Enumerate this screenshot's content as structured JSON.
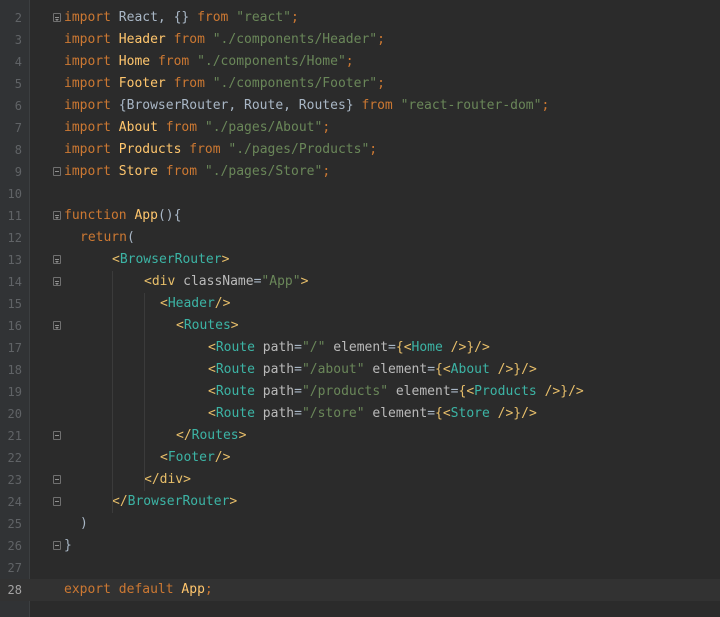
{
  "editor": {
    "language": "javascript-jsx",
    "current_line": 28,
    "colors": {
      "background": "#2b2b2b",
      "gutter": "#313335",
      "keyword": "#cc7832",
      "string": "#6a8759",
      "tag": "#e8bf6a",
      "component": "#3cb4a5",
      "function": "#ffc66d",
      "text": "#a9b7c6"
    },
    "lines": [
      {
        "n": "2",
        "indent": 0,
        "fold": "open",
        "tokens": [
          [
            "kw",
            "import"
          ],
          [
            "def",
            " React, {} "
          ],
          [
            "kw",
            "from"
          ],
          [
            "def",
            " "
          ],
          [
            "str",
            "\"react\""
          ],
          [
            "kw",
            ";"
          ]
        ]
      },
      {
        "n": "3",
        "indent": 0,
        "tokens": [
          [
            "kw",
            "import"
          ],
          [
            "def",
            " "
          ],
          [
            "fn",
            "Header"
          ],
          [
            "def",
            " "
          ],
          [
            "kw",
            "from"
          ],
          [
            "def",
            " "
          ],
          [
            "str",
            "\"./components/Header\""
          ],
          [
            "kw",
            ";"
          ]
        ]
      },
      {
        "n": "4",
        "indent": 0,
        "tokens": [
          [
            "kw",
            "import"
          ],
          [
            "def",
            " "
          ],
          [
            "fn",
            "Home"
          ],
          [
            "def",
            " "
          ],
          [
            "kw",
            "from"
          ],
          [
            "def",
            " "
          ],
          [
            "str",
            "\"./components/Home\""
          ],
          [
            "kw",
            ";"
          ]
        ]
      },
      {
        "n": "5",
        "indent": 0,
        "tokens": [
          [
            "kw",
            "import"
          ],
          [
            "def",
            " "
          ],
          [
            "fn",
            "Footer"
          ],
          [
            "def",
            " "
          ],
          [
            "kw",
            "from"
          ],
          [
            "def",
            " "
          ],
          [
            "str",
            "\"./components/Footer\""
          ],
          [
            "kw",
            ";"
          ]
        ]
      },
      {
        "n": "6",
        "indent": 0,
        "tokens": [
          [
            "kw",
            "import"
          ],
          [
            "def",
            " {"
          ],
          [
            "def",
            "BrowserRouter, Route, Routes"
          ],
          [
            "def",
            "} "
          ],
          [
            "kw",
            "from"
          ],
          [
            "def",
            " "
          ],
          [
            "str",
            "\"react-router-dom\""
          ],
          [
            "kw",
            ";"
          ]
        ]
      },
      {
        "n": "7",
        "indent": 0,
        "tokens": [
          [
            "kw",
            "import"
          ],
          [
            "def",
            " "
          ],
          [
            "fn",
            "About"
          ],
          [
            "def",
            " "
          ],
          [
            "kw",
            "from"
          ],
          [
            "def",
            " "
          ],
          [
            "str",
            "\"./pages/About\""
          ],
          [
            "kw",
            ";"
          ]
        ]
      },
      {
        "n": "8",
        "indent": 0,
        "tokens": [
          [
            "kw",
            "import"
          ],
          [
            "def",
            " "
          ],
          [
            "fn",
            "Products"
          ],
          [
            "def",
            " "
          ],
          [
            "kw",
            "from"
          ],
          [
            "def",
            " "
          ],
          [
            "str",
            "\"./pages/Products\""
          ],
          [
            "kw",
            ";"
          ]
        ]
      },
      {
        "n": "9",
        "indent": 0,
        "fold": "close",
        "tokens": [
          [
            "kw",
            "import"
          ],
          [
            "def",
            " "
          ],
          [
            "fn",
            "Store"
          ],
          [
            "def",
            " "
          ],
          [
            "kw",
            "from"
          ],
          [
            "def",
            " "
          ],
          [
            "str",
            "\"./pages/Store\""
          ],
          [
            "kw",
            ";"
          ]
        ]
      },
      {
        "n": "10",
        "indent": 0,
        "tokens": []
      },
      {
        "n": "11",
        "indent": 0,
        "fold": "open",
        "tokens": [
          [
            "kw",
            "function"
          ],
          [
            "def",
            " "
          ],
          [
            "fn",
            "App"
          ],
          [
            "def",
            "(){"
          ]
        ]
      },
      {
        "n": "12",
        "indent": 2,
        "tokens": [
          [
            "kw",
            "return"
          ],
          [
            "def",
            "("
          ]
        ]
      },
      {
        "n": "13",
        "indent": 6,
        "fold": "open",
        "tokens": [
          [
            "tag",
            "<"
          ],
          [
            "comp",
            "BrowserRouter"
          ],
          [
            "tag",
            ">"
          ]
        ]
      },
      {
        "n": "14",
        "indent": 10,
        "fold": "open",
        "tokens": [
          [
            "tag",
            "<div"
          ],
          [
            "def",
            " "
          ],
          [
            "attr",
            "className"
          ],
          [
            "def",
            "="
          ],
          [
            "str",
            "\"App\""
          ],
          [
            "tag",
            ">"
          ]
        ]
      },
      {
        "n": "15",
        "indent": 12,
        "tokens": [
          [
            "tag",
            "<"
          ],
          [
            "comp",
            "Header"
          ],
          [
            "tag",
            "/>"
          ]
        ]
      },
      {
        "n": "16",
        "indent": 14,
        "fold": "open",
        "tokens": [
          [
            "tag",
            "<"
          ],
          [
            "comp",
            "Routes"
          ],
          [
            "tag",
            ">"
          ]
        ]
      },
      {
        "n": "17",
        "indent": 18,
        "tokens": [
          [
            "tag",
            "<"
          ],
          [
            "comp",
            "Route"
          ],
          [
            "def",
            " "
          ],
          [
            "attr",
            "path"
          ],
          [
            "def",
            "="
          ],
          [
            "str",
            "\"/\""
          ],
          [
            "def",
            " "
          ],
          [
            "attr",
            "element"
          ],
          [
            "def",
            "="
          ],
          [
            "brace",
            "{"
          ],
          [
            "tag",
            "<"
          ],
          [
            "comp",
            "Home"
          ],
          [
            "def",
            " "
          ],
          [
            "tag",
            "/>"
          ],
          [
            "brace",
            "}"
          ],
          [
            "tag",
            "/>"
          ]
        ]
      },
      {
        "n": "18",
        "indent": 18,
        "tokens": [
          [
            "tag",
            "<"
          ],
          [
            "comp",
            "Route"
          ],
          [
            "def",
            " "
          ],
          [
            "attr",
            "path"
          ],
          [
            "def",
            "="
          ],
          [
            "str",
            "\"/about\""
          ],
          [
            "def",
            " "
          ],
          [
            "attr",
            "element"
          ],
          [
            "def",
            "="
          ],
          [
            "brace",
            "{"
          ],
          [
            "tag",
            "<"
          ],
          [
            "comp",
            "About"
          ],
          [
            "def",
            " "
          ],
          [
            "tag",
            "/>"
          ],
          [
            "brace",
            "}"
          ],
          [
            "tag",
            "/>"
          ]
        ]
      },
      {
        "n": "19",
        "indent": 18,
        "tokens": [
          [
            "tag",
            "<"
          ],
          [
            "comp",
            "Route"
          ],
          [
            "def",
            " "
          ],
          [
            "attr",
            "path"
          ],
          [
            "def",
            "="
          ],
          [
            "str",
            "\"/products\""
          ],
          [
            "def",
            " "
          ],
          [
            "attr",
            "element"
          ],
          [
            "def",
            "="
          ],
          [
            "brace",
            "{"
          ],
          [
            "tag",
            "<"
          ],
          [
            "comp",
            "Products"
          ],
          [
            "def",
            " "
          ],
          [
            "tag",
            "/>"
          ],
          [
            "brace",
            "}"
          ],
          [
            "tag",
            "/>"
          ]
        ]
      },
      {
        "n": "20",
        "indent": 18,
        "tokens": [
          [
            "tag",
            "<"
          ],
          [
            "comp",
            "Route"
          ],
          [
            "def",
            " "
          ],
          [
            "attr",
            "path"
          ],
          [
            "def",
            "="
          ],
          [
            "str",
            "\"/store\""
          ],
          [
            "def",
            " "
          ],
          [
            "attr",
            "element"
          ],
          [
            "def",
            "="
          ],
          [
            "brace",
            "{"
          ],
          [
            "tag",
            "<"
          ],
          [
            "comp",
            "Store"
          ],
          [
            "def",
            " "
          ],
          [
            "tag",
            "/>"
          ],
          [
            "brace",
            "}"
          ],
          [
            "tag",
            "/>"
          ]
        ]
      },
      {
        "n": "21",
        "indent": 14,
        "fold": "close",
        "tokens": [
          [
            "tag",
            "</"
          ],
          [
            "comp",
            "Routes"
          ],
          [
            "tag",
            ">"
          ]
        ]
      },
      {
        "n": "22",
        "indent": 12,
        "tokens": [
          [
            "tag",
            "<"
          ],
          [
            "comp",
            "Footer"
          ],
          [
            "tag",
            "/>"
          ]
        ]
      },
      {
        "n": "23",
        "indent": 10,
        "fold": "close",
        "tokens": [
          [
            "tag",
            "</div>"
          ]
        ]
      },
      {
        "n": "24",
        "indent": 6,
        "fold": "close",
        "tokens": [
          [
            "tag",
            "</"
          ],
          [
            "comp",
            "BrowserRouter"
          ],
          [
            "tag",
            ">"
          ]
        ]
      },
      {
        "n": "25",
        "indent": 2,
        "tokens": [
          [
            "def",
            ")"
          ]
        ]
      },
      {
        "n": "26",
        "indent": 0,
        "fold": "close",
        "tokens": [
          [
            "def",
            "}"
          ]
        ]
      },
      {
        "n": "27",
        "indent": 0,
        "tokens": []
      },
      {
        "n": "28",
        "indent": 0,
        "tokens": [
          [
            "kw",
            "export"
          ],
          [
            "def",
            " "
          ],
          [
            "kw",
            "default"
          ],
          [
            "def",
            " "
          ],
          [
            "fn",
            "App"
          ],
          [
            "kw",
            ";"
          ]
        ]
      }
    ]
  }
}
